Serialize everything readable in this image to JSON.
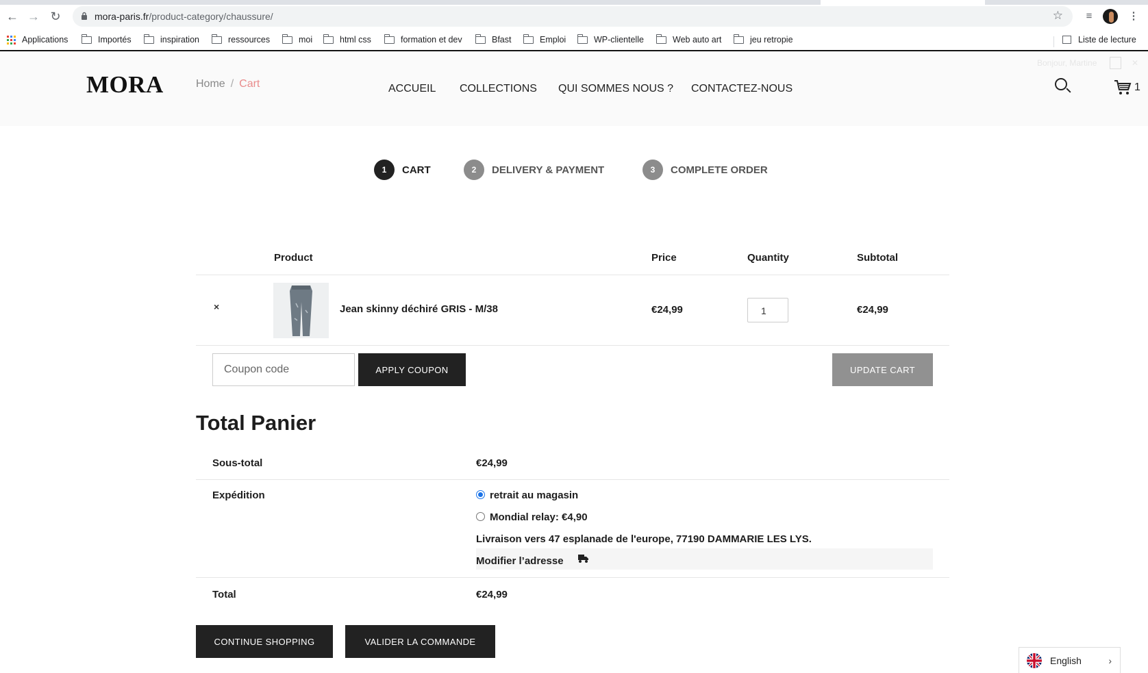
{
  "browser": {
    "url_host": "mora-paris.fr",
    "url_path": "/product-category/chaussure/",
    "bookmarks": [
      "Applications",
      "Importés",
      "inspiration",
      "ressources",
      "moi",
      "html css",
      "formation et dev",
      "Bfast",
      "Emploi",
      "WP-clientelle",
      "Web auto art",
      "jeu retropie"
    ],
    "reading_list": "Liste de lecture"
  },
  "header": {
    "logo": "MORA",
    "breadcrumb": {
      "home": "Home",
      "separator": "/",
      "current": "Cart"
    },
    "nav": [
      "ACCUEIL",
      "COLLECTIONS",
      "QUI SOMMES NOUS ?",
      "CONTACTEZ-NOUS"
    ],
    "user_greeting": "Bonjour, Martine",
    "cart_count": "1"
  },
  "steps": [
    {
      "num": "1",
      "label": "CART",
      "active": true
    },
    {
      "num": "2",
      "label": "DELIVERY & PAYMENT",
      "active": false
    },
    {
      "num": "3",
      "label": "COMPLETE ORDER",
      "active": false
    }
  ],
  "cart_table": {
    "headers": {
      "product": "Product",
      "price": "Price",
      "quantity": "Quantity",
      "subtotal": "Subtotal"
    },
    "items": [
      {
        "remove": "×",
        "name": "Jean skinny déchiré GRIS - M/38",
        "price": "€24,99",
        "quantity": "1",
        "subtotal": "€24,99"
      }
    ]
  },
  "coupon": {
    "placeholder": "Coupon code",
    "apply_label": "APPLY COUPON",
    "update_label": "UPDATE CART"
  },
  "totals": {
    "title": "Total Panier",
    "subtotal_label": "Sous-total",
    "subtotal_value": "€24,99",
    "shipping_label": "Expédition",
    "shipping_options": [
      {
        "label": "retrait au magasin",
        "selected": true
      },
      {
        "label": "Mondial relay: €4,90",
        "selected": false
      }
    ],
    "delivery_address": "Livraison vers 47 esplanade de l'europe, 77190 DAMMARIE LES LYS.",
    "change_address": "Modifier l’adresse",
    "total_label": "Total",
    "total_value": "€24,99"
  },
  "actions": {
    "continue": "CONTINUE SHOPPING",
    "checkout": "VALIDER LA COMMANDE"
  },
  "language": {
    "label": "English"
  },
  "colors": {
    "dark": "#222222",
    "grey_button": "#919191",
    "breadcrumb_active": "#e98b8b",
    "step_inactive": "#8c8c8c",
    "radio": "#1a73e8"
  }
}
